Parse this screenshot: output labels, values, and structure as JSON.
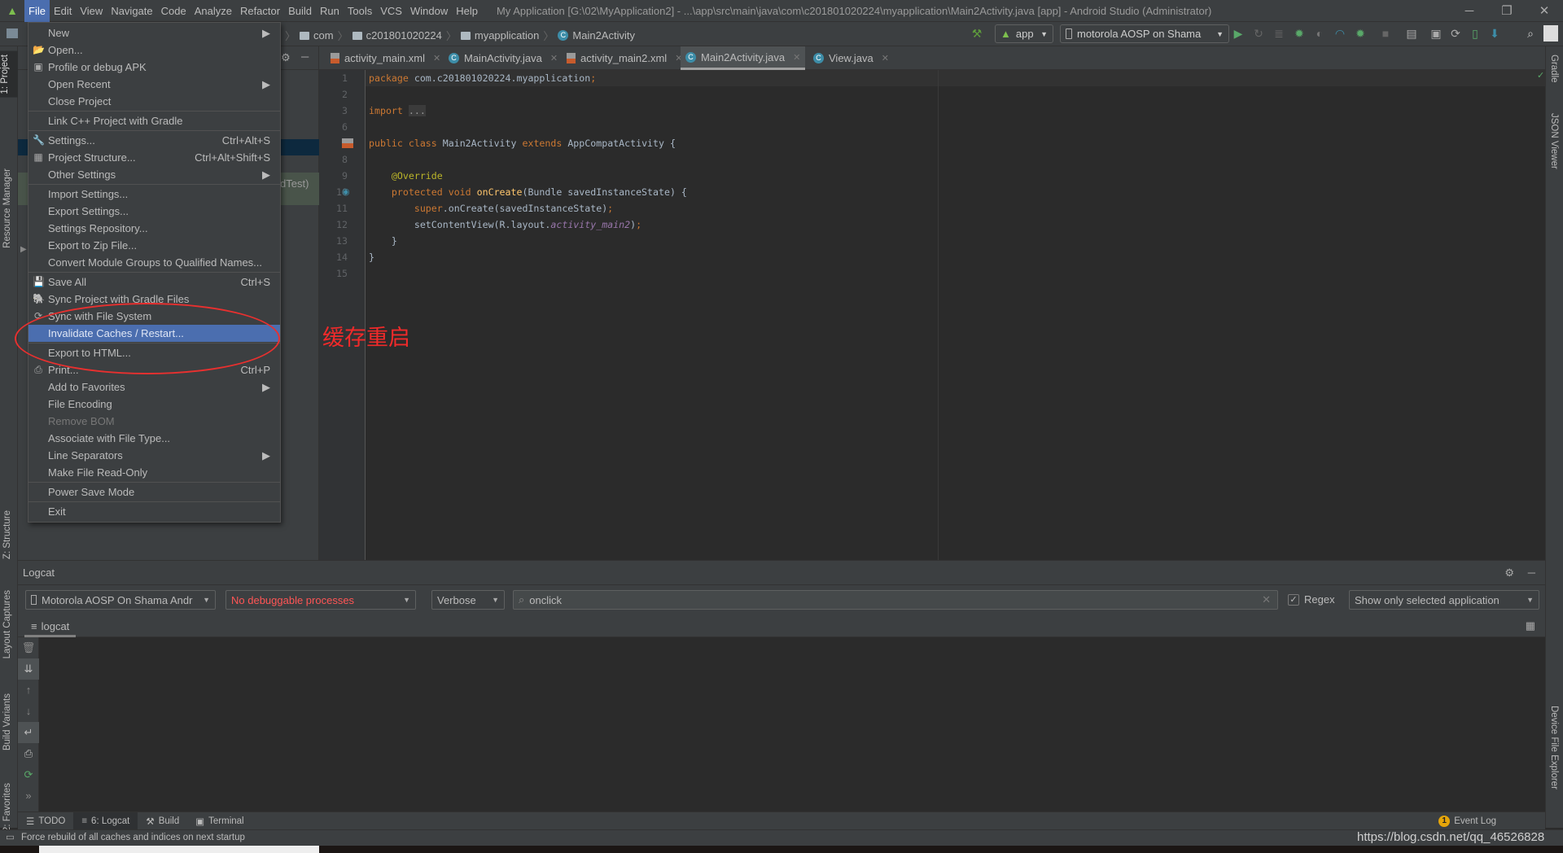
{
  "app": {
    "menu": [
      "File",
      "Edit",
      "View",
      "Navigate",
      "Code",
      "Analyze",
      "Refactor",
      "Build",
      "Run",
      "Tools",
      "VCS",
      "Window",
      "Help"
    ],
    "window_title": "My Application [G:\\02\\MyApplication2] - ...\\app\\src\\main\\java\\com\\c201801020224\\myapplication\\Main2Activity.java [app] - Android Studio (Administrator)"
  },
  "breadcrumb": [
    "com",
    "c201801020224",
    "myapplication",
    "Main2Activity"
  ],
  "toolbar": {
    "run_config": "app",
    "device": "motorola AOSP on Shama"
  },
  "tabs": [
    {
      "label": "activity_main.xml",
      "type": "xml"
    },
    {
      "label": "MainActivity.java",
      "type": "class"
    },
    {
      "label": "activity_main2.xml",
      "type": "xml"
    },
    {
      "label": "Main2Activity.java",
      "type": "class",
      "active": true
    },
    {
      "label": "View.java",
      "type": "class"
    }
  ],
  "project_panel": {
    "partial_text": "dTest)"
  },
  "left_strip": [
    "1: Project",
    "Resource Manager",
    "Z: Structure",
    "Layout Captures",
    "Build Variants",
    "2: Favorites"
  ],
  "right_strip": [
    "Gradle",
    "JSON Viewer",
    "Device File Explorer"
  ],
  "editor": {
    "lines": [
      {
        "n": "1",
        "tokens": [
          [
            "kw",
            "package "
          ],
          [
            "",
            "com.c201801020224.myapplication"
          ],
          [
            "kw",
            ";"
          ]
        ]
      },
      {
        "n": "2",
        "tokens": []
      },
      {
        "n": "3",
        "tokens": [
          [
            "kw",
            "import "
          ],
          [
            "fold",
            "..."
          ]
        ]
      },
      {
        "n": "6",
        "tokens": []
      },
      {
        "n": "7",
        "tokens": [
          [
            "kw",
            "public class "
          ],
          [
            "",
            "Main2Activity "
          ],
          [
            "kw",
            "extends "
          ],
          [
            "",
            "AppCompatActivity {"
          ]
        ]
      },
      {
        "n": "8",
        "tokens": []
      },
      {
        "n": "9",
        "tokens": [
          [
            "an",
            "    @Override"
          ]
        ]
      },
      {
        "n": "10",
        "tokens": [
          [
            "kw",
            "    protected void "
          ],
          [
            "fn",
            "onCreate"
          ],
          [
            "",
            "(Bundle savedInstanceState) {"
          ]
        ]
      },
      {
        "n": "11",
        "tokens": [
          [
            "kw",
            "        super"
          ],
          [
            "",
            ".onCreate(savedInstanceState)"
          ],
          [
            "kw",
            ";"
          ]
        ]
      },
      {
        "n": "12",
        "tokens": [
          [
            "",
            "        setContentView(R.layout."
          ],
          [
            "it",
            "activity_main2"
          ],
          [
            "",
            ")"
          ],
          [
            "kw",
            ";"
          ]
        ]
      },
      {
        "n": "13",
        "tokens": [
          [
            "",
            "    }"
          ]
        ]
      },
      {
        "n": "14",
        "tokens": [
          [
            "",
            "}"
          ]
        ]
      },
      {
        "n": "15",
        "tokens": []
      }
    ]
  },
  "file_menu": [
    {
      "label": "New",
      "submenu": true
    },
    {
      "label": "Open...",
      "icon": "folder-open-icon"
    },
    {
      "label": "Profile or debug APK",
      "icon": "apk-icon"
    },
    {
      "label": "Open Recent",
      "submenu": true
    },
    {
      "label": "Close Project"
    },
    {
      "sep": true
    },
    {
      "label": "Link C++ Project with Gradle"
    },
    {
      "sep": true
    },
    {
      "label": "Settings...",
      "shortcut": "Ctrl+Alt+S",
      "icon": "wrench-icon"
    },
    {
      "label": "Project Structure...",
      "shortcut": "Ctrl+Alt+Shift+S",
      "icon": "project-structure-icon"
    },
    {
      "label": "Other Settings",
      "submenu": true
    },
    {
      "sep": true
    },
    {
      "label": "Import Settings..."
    },
    {
      "label": "Export Settings..."
    },
    {
      "label": "Settings Repository..."
    },
    {
      "label": "Export to Zip File..."
    },
    {
      "label": "Convert Module Groups to Qualified Names..."
    },
    {
      "sep": true
    },
    {
      "label": "Save All",
      "shortcut": "Ctrl+S",
      "icon": "save-icon"
    },
    {
      "label": "Sync Project with Gradle Files",
      "icon": "gradle-sync-icon"
    },
    {
      "label": "Sync with File System",
      "icon": "refresh-icon"
    },
    {
      "label": "Invalidate Caches / Restart...",
      "highlighted": true
    },
    {
      "sep": true
    },
    {
      "label": "Export to HTML..."
    },
    {
      "label": "Print...",
      "shortcut": "Ctrl+P",
      "icon": "print-icon"
    },
    {
      "label": "Add to Favorites",
      "submenu": true
    },
    {
      "label": "File Encoding"
    },
    {
      "label": "Remove BOM",
      "disabled": true
    },
    {
      "label": "Associate with File Type..."
    },
    {
      "label": "Line Separators",
      "submenu": true
    },
    {
      "label": "Make File Read-Only"
    },
    {
      "sep": true
    },
    {
      "label": "Power Save Mode"
    },
    {
      "sep": true
    },
    {
      "label": "Exit"
    }
  ],
  "annotation": {
    "text": "缓存重启",
    "color": "#e8302f"
  },
  "logcat": {
    "title": "Logcat",
    "device": "Motorola AOSP On Shama Andr",
    "process": "No debuggable processes",
    "level": "Verbose",
    "search": "onclick",
    "regex_label": "Regex",
    "regex_checked": true,
    "filter": "Show only selected application",
    "tab": "logcat"
  },
  "bottom_tabs": [
    "TODO",
    "6: Logcat",
    "Build",
    "Terminal"
  ],
  "event_log": {
    "label": "Event Log",
    "count": "1"
  },
  "status": {
    "message": "Force rebuild of all caches and indices on next startup",
    "watermark": "https://blog.csdn.net/qq_46526828"
  },
  "colors": {
    "accent": "#4b6eaf",
    "keyword": "#cc7832",
    "annotation": "#bbb529",
    "method": "#ffc66d",
    "error_text": "#ff5555"
  }
}
